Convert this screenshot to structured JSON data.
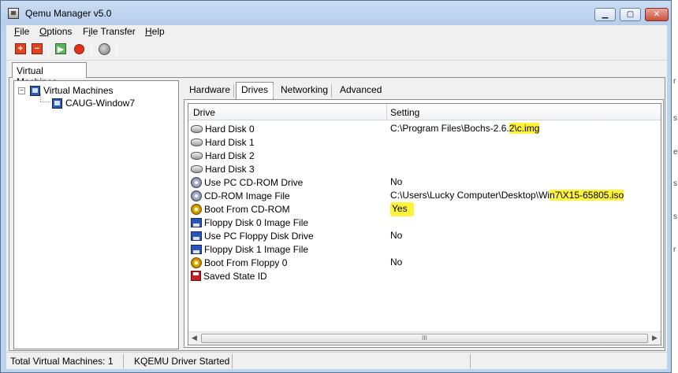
{
  "window": {
    "title": "Qemu Manager v5.0"
  },
  "menu": [
    {
      "label": "File",
      "accel": "F",
      "rest": "ile"
    },
    {
      "label": "Options",
      "accel": "O",
      "rest": "ptions"
    },
    {
      "label": "File Transfer",
      "pre": "F",
      "accel": "i",
      "rest": "le Transfer"
    },
    {
      "label": "Help",
      "accel": "H",
      "rest": "elp"
    }
  ],
  "toolbar": {
    "icons": [
      "add-vm-icon",
      "remove-vm-icon",
      "start-vm-icon",
      "stop-vm-icon",
      "network-globe-icon"
    ]
  },
  "left_tab": {
    "label": "Virtual Machines"
  },
  "tree": {
    "root": "Virtual Machines",
    "expander": "−",
    "child": "CAUG-Window7"
  },
  "tabs": [
    {
      "label": "Hardware",
      "selected": false
    },
    {
      "label": "Drives",
      "selected": true
    },
    {
      "label": "Networking",
      "selected": false
    },
    {
      "label": "Advanced",
      "selected": false
    }
  ],
  "drives_list": {
    "columns": [
      "Drive",
      "Setting"
    ],
    "rows": [
      {
        "icon": "hard-disk-icon",
        "drive": "Hard Disk 0",
        "setting": "C:\\Program Files\\Bochs-2.6.2\\c.img"
      },
      {
        "icon": "hard-disk-icon",
        "drive": "Hard Disk 1",
        "setting": ""
      },
      {
        "icon": "hard-disk-icon",
        "drive": "Hard Disk 2",
        "setting": ""
      },
      {
        "icon": "hard-disk-icon",
        "drive": "Hard Disk 3",
        "setting": ""
      },
      {
        "icon": "cd-rom-icon",
        "drive": "Use PC CD-ROM Drive",
        "setting": "No"
      },
      {
        "icon": "cd-rom-icon",
        "drive": "CD-ROM Image File",
        "setting": "C:\\Users\\Lucky Computer\\Desktop\\Win7\\X15-65805.iso"
      },
      {
        "icon": "gear-icon",
        "drive": "Boot From CD-ROM",
        "setting": "Yes"
      },
      {
        "icon": "floppy-icon",
        "drive": "Floppy Disk 0 Image File",
        "setting": ""
      },
      {
        "icon": "floppy-drive-icon",
        "drive": "Use PC Floppy Disk Drive",
        "setting": "No"
      },
      {
        "icon": "floppy-icon",
        "drive": "Floppy Disk 1 Image File",
        "setting": ""
      },
      {
        "icon": "gear-icon",
        "drive": "Boot From Floppy 0",
        "setting": "No"
      },
      {
        "icon": "save-state-icon",
        "drive": "Saved State ID",
        "setting": ""
      }
    ],
    "hd0_parts": {
      "plain": "C:\\Program Files\\Bochs-2.6.",
      "highlighted": "2\\c.img"
    },
    "cd_parts": {
      "plain": "C:\\Users\\Lucky Computer\\Desktop\\Wi",
      "highlighted": "n7\\X15-65805.iso"
    },
    "scroll_thumb": "III"
  },
  "status": {
    "vm_count": "Total Virtual Machines: 1",
    "kqemu": "KQEMU Driver Started"
  },
  "colors": {
    "highlight": "#fff23a",
    "titlebar": "#bcd3ee"
  }
}
